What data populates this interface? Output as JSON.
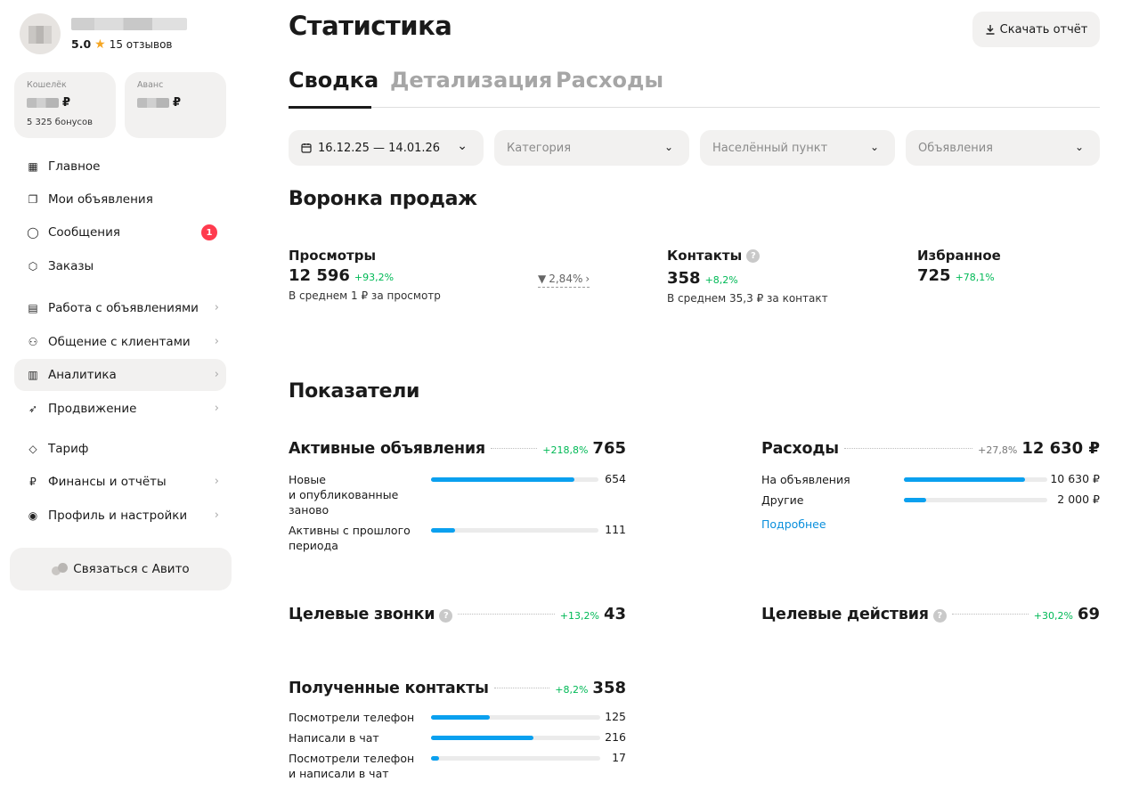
{
  "profile": {
    "rating": "5.0",
    "reviews": "15 отзывов"
  },
  "wallet": {
    "label": "Кошелёк",
    "currency": "₽",
    "bonus": "5 325 бонусов"
  },
  "advance": {
    "label": "Аванс",
    "currency": "₽"
  },
  "nav": [
    {
      "label": "Главное",
      "icon": "grid-icon"
    },
    {
      "label": "Мои объявления",
      "icon": "copy-icon"
    },
    {
      "label": "Сообщения",
      "icon": "chat-icon",
      "badge": "1"
    },
    {
      "label": "Заказы",
      "icon": "box-icon"
    },
    {
      "label": "Работа с объявлениями",
      "icon": "layout-icon"
    },
    {
      "label": "Общение с клиентами",
      "icon": "users-icon"
    },
    {
      "label": "Аналитика",
      "icon": "chart-icon"
    },
    {
      "label": "Продвижение",
      "icon": "rocket-icon"
    },
    {
      "label": "Тариф",
      "icon": "diamond-icon"
    },
    {
      "label": "Финансы и отчёты",
      "icon": "ruble-icon"
    },
    {
      "label": "Профиль и настройки",
      "icon": "user-icon"
    }
  ],
  "contact_button": "Связаться с Авито",
  "page_title": "Статистика",
  "download_button": "Скачать отчёт",
  "tabs": [
    "Сводка",
    "Детализация",
    "Расходы"
  ],
  "filters": {
    "date": "16.12.25 — 14.01.26",
    "category": "Категория",
    "city": "Населённый пункт",
    "ads": "Объявления"
  },
  "funnel": {
    "title": "Воронка продаж",
    "views": {
      "label": "Просмотры",
      "value": "12 596",
      "delta": "+93,2%",
      "note": "В среднем 1 ₽ за просмотр",
      "conversion": "2,84%"
    },
    "contacts": {
      "label": "Контакты",
      "value": "358",
      "delta": "+8,2%",
      "note": "В среднем 35,3 ₽ за контакт"
    },
    "favorites": {
      "label": "Избранное",
      "value": "725",
      "delta": "+78,1%"
    }
  },
  "metrics_title": "Показатели",
  "active_ads": {
    "title": "Активные объявления",
    "delta": "+218,8%",
    "value": "765",
    "rows": [
      {
        "label": "Новые\nи опубликованные\nзаново",
        "value": "654",
        "fraction": 0.855
      },
      {
        "label": "Активны с прошлого\nпериода",
        "value": "111",
        "fraction": 0.145
      }
    ]
  },
  "expenses": {
    "title": "Расходы",
    "delta": "+27,8%",
    "value": "12 630 ₽",
    "rows": [
      {
        "label": "На объявления",
        "value": "10 630 ₽",
        "fraction": 0.842
      },
      {
        "label": "Другие",
        "value": "2 000 ₽",
        "fraction": 0.158
      }
    ],
    "link": "Подробнее"
  },
  "calls": {
    "title": "Целевые звонки",
    "delta": "+13,2%",
    "value": "43"
  },
  "actions": {
    "title": "Целевые действия",
    "delta": "+30,2%",
    "value": "69"
  },
  "received": {
    "title": "Полученные контакты",
    "delta": "+8,2%",
    "value": "358",
    "rows": [
      {
        "label": "Посмотрели телефон",
        "value": "125",
        "fraction": 0.349
      },
      {
        "label": "Написали в чат",
        "value": "216",
        "fraction": 0.603
      },
      {
        "label": "Посмотрели телефон\nи написали в чат",
        "value": "17",
        "fraction": 0.047
      }
    ]
  }
}
